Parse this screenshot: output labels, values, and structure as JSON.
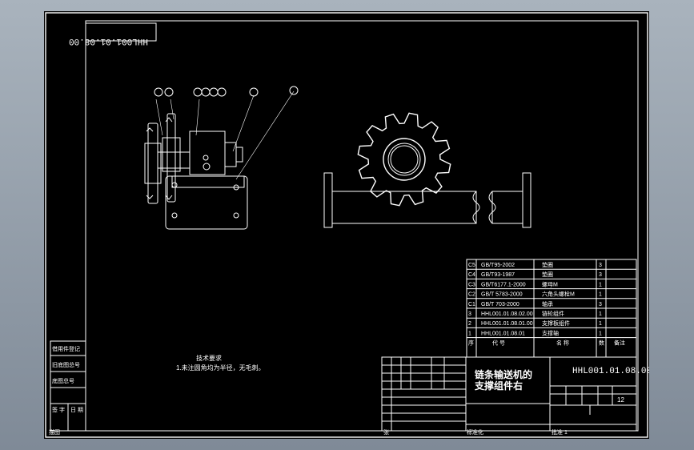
{
  "drawing": {
    "code_mirrored": "HHL001.01.08.00",
    "code": "HHL001.01.08.00",
    "title_line1": "链条输送机的",
    "title_line2": "支撑组件右",
    "sheet_label": "12",
    "tech_req_title": "技术要求",
    "tech_req_1": "1.未注圆角均为半径，无毛刺。",
    "callouts": [
      "⑦⑧",
      "①⑨⑩⑪",
      "⑤",
      "②"
    ]
  },
  "parts_list": [
    {
      "no": "C5",
      "code": "GB/T95-2002",
      "name": "垫圈",
      "qty": "3"
    },
    {
      "no": "C4",
      "code": "GB/T93-1987",
      "name": "垫圈",
      "qty": "3"
    },
    {
      "no": "C3",
      "code": "GB/T6177.1-2000",
      "name": "螺母M",
      "qty": "1"
    },
    {
      "no": "C2",
      "code": "GB/T 5783-2000",
      "name": "六角头螺栓M",
      "qty": "1"
    },
    {
      "no": "C1",
      "code": "GB/T 703-2000",
      "name": "轴承",
      "qty": "3"
    },
    {
      "no": "3",
      "code": "HHL001.01.08.02.00",
      "name": "链轮组件",
      "qty": "1"
    },
    {
      "no": "2",
      "code": "HHL001.01.08.01.00",
      "name": "支撑板组件",
      "qty": "1"
    },
    {
      "no": "1",
      "code": "HHL001.01.08.01",
      "name": "支撑轴",
      "qty": "1"
    }
  ],
  "parts_header": {
    "no": "序",
    "code": "代 号",
    "name": "名 称",
    "qty": "数",
    "mat": "备注"
  },
  "left_blocks": [
    "借用件登记",
    "旧底图总号",
    "底图总号",
    "签 字",
    "日 期"
  ],
  "bottom_labels": {
    "left": "描图",
    "mid1": "张",
    "mid2": "标准化",
    "right": "批准 1"
  },
  "colors": {
    "background": "#000000",
    "lines": "#ffffff",
    "frame_outer": "#8f9aa7"
  }
}
